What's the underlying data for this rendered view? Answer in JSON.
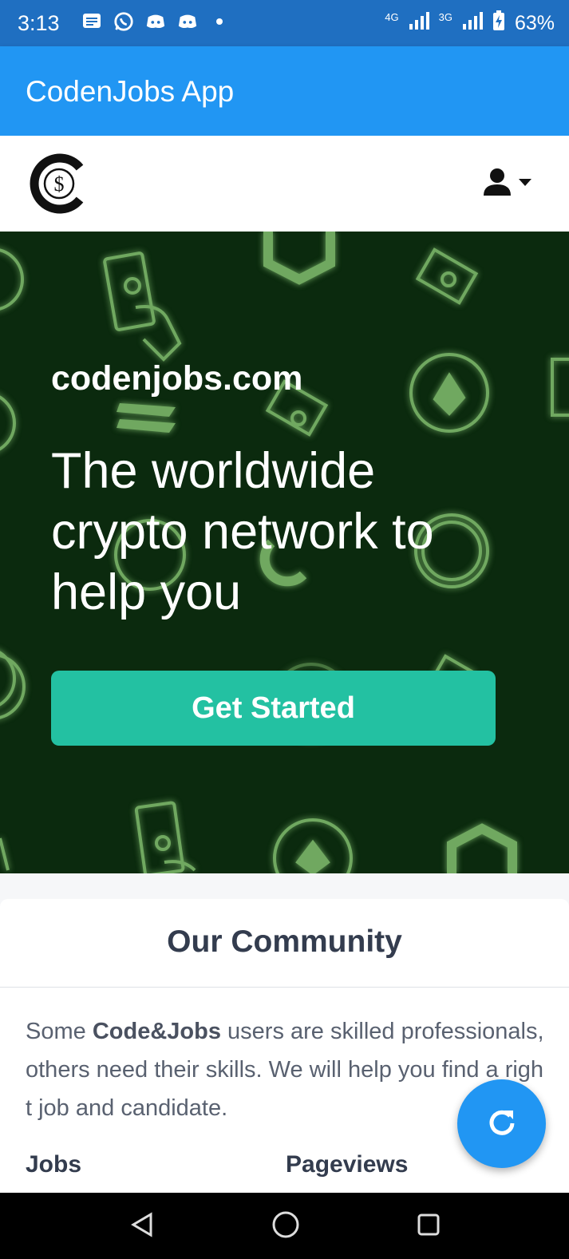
{
  "status_bar": {
    "time": "3:13",
    "network_1": "4G",
    "network_2": "3G",
    "battery": "63%",
    "icons_left": [
      "message-icon",
      "whatsapp-icon",
      "discord-icon",
      "discord-icon",
      "dot-icon"
    ],
    "icons_right": [
      "signal-icon",
      "signal-icon",
      "battery-charging-icon"
    ]
  },
  "app_bar": {
    "title": "CodenJobs App"
  },
  "header": {
    "logo_icon": "codenjobs-logo",
    "user_icon": "user-icon",
    "menu_icon": "caret-down-icon"
  },
  "hero": {
    "domain": "codenjobs.com",
    "headline": "The worldwide crypto network to help you",
    "cta_label": "Get Started"
  },
  "community": {
    "title": "Our Community",
    "text_pre": "Some ",
    "text_bold": "Code&Jobs",
    "text_post": " users are skilled professionals, others need their skills. We will help you find a right job and candidate.",
    "stats": [
      {
        "label": "Jobs",
        "value": ""
      },
      {
        "label": "Pageviews",
        "value": ""
      }
    ]
  },
  "fab": {
    "icon": "refresh-icon"
  },
  "nav": {
    "back_icon": "back-icon",
    "home_icon": "home-icon",
    "recents_icon": "recents-icon"
  },
  "colors": {
    "app_bar": "#2196f3",
    "status_bar": "#1f6fc1",
    "hero_bg": "#0b2a0e",
    "cta": "#23c1a2",
    "icon_green": "#6fa860"
  }
}
